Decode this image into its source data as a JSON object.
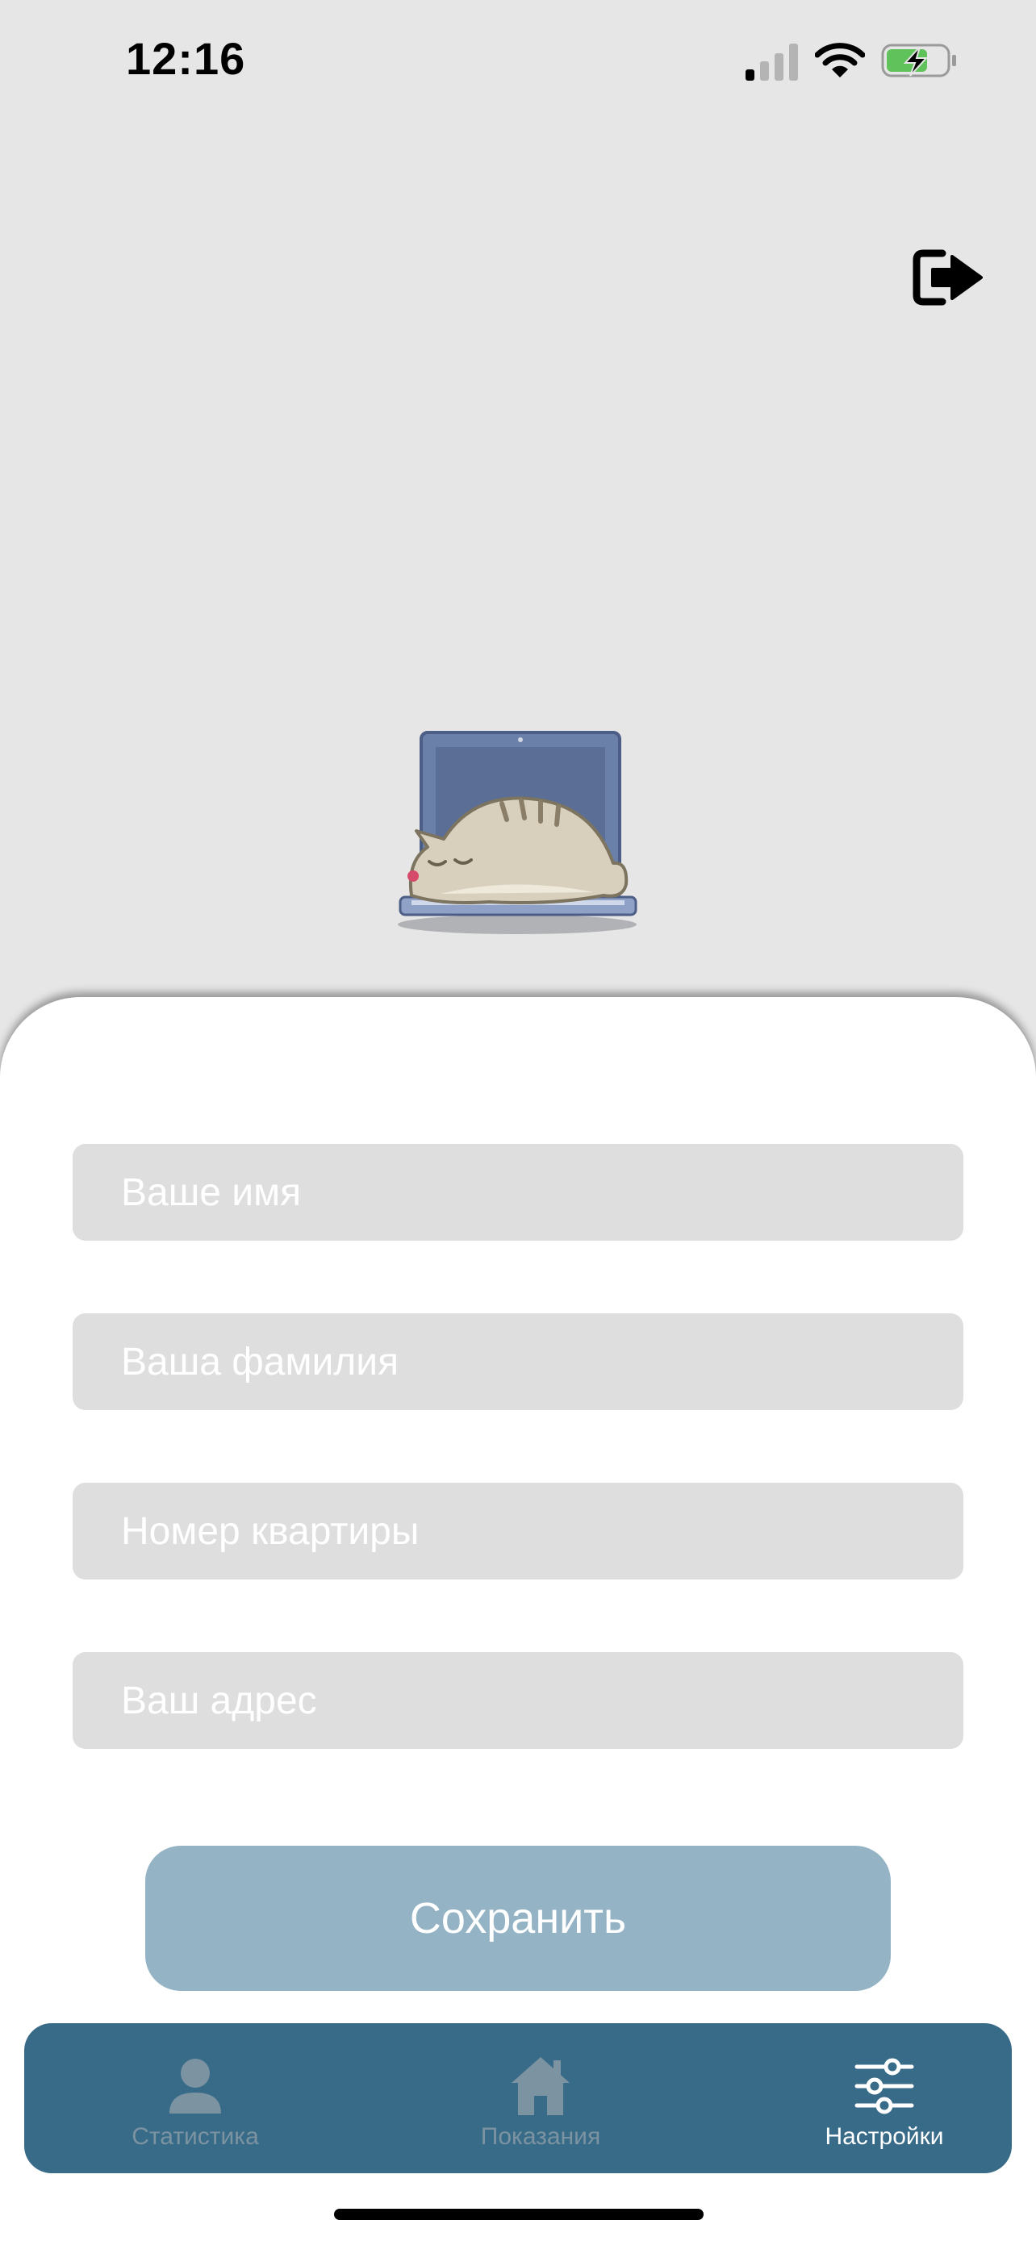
{
  "status_bar": {
    "time": "12:16"
  },
  "icons": {
    "signal": "signal-icon",
    "wifi": "wifi-icon",
    "battery": "battery-charging-icon",
    "logout": "logout-icon",
    "illustration": "cat-on-laptop-illustration"
  },
  "form": {
    "name_placeholder": "Ваше имя",
    "surname_placeholder": "Ваша фамилия",
    "apartment_placeholder": "Номер квартиры",
    "address_placeholder": "Ваш адрес",
    "save_label": "Сохранить"
  },
  "tabbar": {
    "tabs": [
      {
        "label": "Статистика",
        "icon": "person-icon",
        "active": false
      },
      {
        "label": "Показания",
        "icon": "house-icon",
        "active": false
      },
      {
        "label": "Настройки",
        "icon": "sliders-icon",
        "active": true
      }
    ]
  },
  "colors": {
    "background": "#e6e6e6",
    "field": "#dedede",
    "save_button": "#94b3c4",
    "tabbar": "#386b88",
    "tab_inactive": "#7c93a1",
    "tab_active": "#ffffff",
    "battery_fill": "#5fc25a"
  }
}
